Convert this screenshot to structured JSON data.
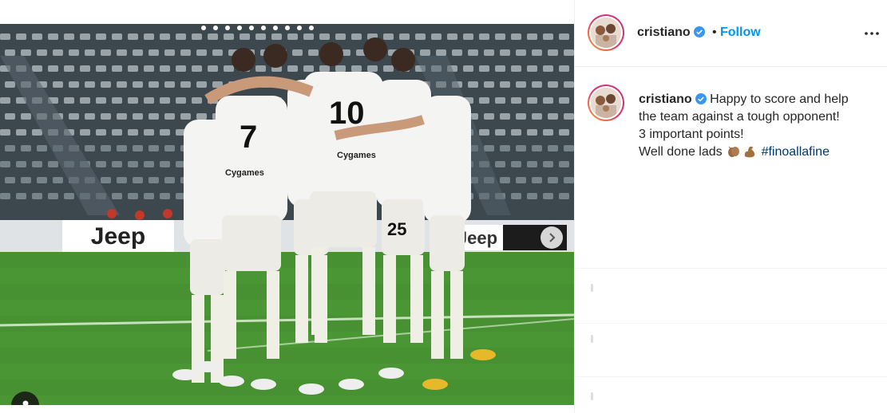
{
  "post": {
    "username": "cristiano",
    "follow_label": "Follow",
    "separator": "•",
    "caption_lines": [
      "Happy to score and help",
      "the team against a tough opponent!",
      "3 important points!",
      "Well done lads"
    ],
    "hashtag": "#finoallafine"
  },
  "photo": {
    "sign_left": "Jeep",
    "sign_right": "Jeep",
    "sponsor": "Cygames",
    "numbers": [
      "7",
      "10",
      "25"
    ]
  },
  "colors": {
    "accent": "#0095f6",
    "hashtag": "#00376b",
    "verified": "#3897f0",
    "pitch": "#3f8a2e"
  },
  "icons": {
    "verified": "verified-badge-icon",
    "more": "more-options-icon",
    "next": "chevron-right-icon",
    "tag": "user-tag-icon",
    "emoji1": "clapping-hands-emoji",
    "emoji2": "flexed-biceps-emoji"
  }
}
